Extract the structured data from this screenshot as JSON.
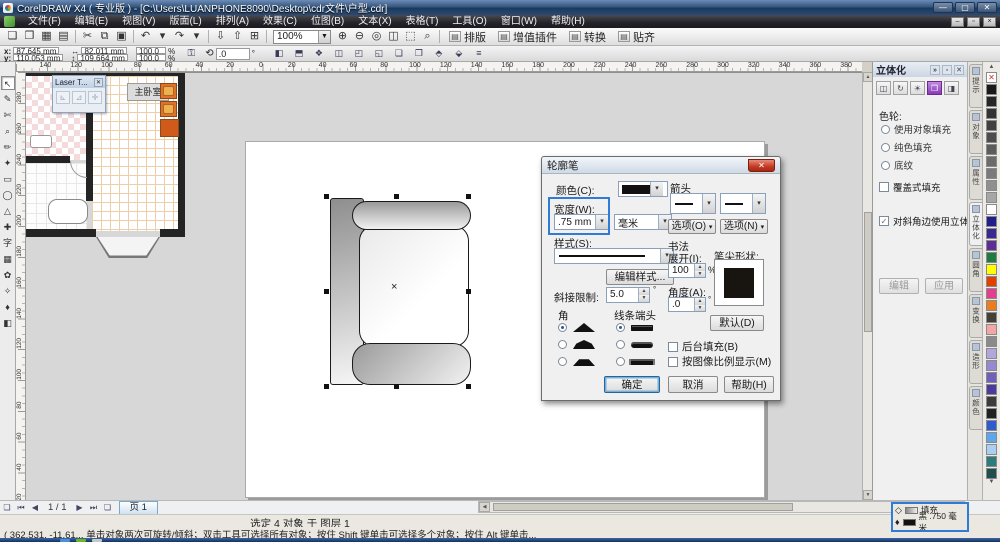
{
  "window": {
    "title": "CorelDRAW X4 ( 专业版 ) - [C:\\Users\\LUANPHONE8090\\Desktop\\cdr文件\\户型.cdr]",
    "minimize": "—",
    "maximize": "▢",
    "close": "✕"
  },
  "menu": {
    "items": [
      "文件(F)",
      "编辑(E)",
      "视图(V)",
      "版面(L)",
      "排列(A)",
      "效果(C)",
      "位图(B)",
      "文本(X)",
      "表格(T)",
      "工具(O)",
      "窗口(W)",
      "帮助(H)"
    ]
  },
  "toolbar": {
    "file_icons": [
      {
        "name": "new-icon",
        "glyph": "❏"
      },
      {
        "name": "open-icon",
        "glyph": "❐"
      },
      {
        "name": "save-icon",
        "glyph": "▦"
      },
      {
        "name": "print-icon",
        "glyph": "▤"
      }
    ],
    "edit_icons": [
      {
        "name": "cut-icon",
        "glyph": "✂"
      },
      {
        "name": "copy-icon",
        "glyph": "⧉"
      },
      {
        "name": "paste-icon",
        "glyph": "▣"
      }
    ],
    "undo_icons": [
      {
        "name": "undo-icon",
        "glyph": "↶"
      },
      {
        "name": "undo-dropdown-icon",
        "glyph": "▾"
      },
      {
        "name": "redo-icon",
        "glyph": "↷"
      },
      {
        "name": "redo-dropdown-icon",
        "glyph": "▾"
      }
    ],
    "io_icons": [
      {
        "name": "import-icon",
        "glyph": "⇩"
      },
      {
        "name": "export-icon",
        "glyph": "⇧"
      },
      {
        "name": "app-launcher-icon",
        "glyph": "⊞"
      }
    ],
    "zoom_value": "100%",
    "zoom_icons": [
      {
        "name": "zoom-in-icon",
        "glyph": "⊕"
      },
      {
        "name": "zoom-out-icon",
        "glyph": "⊖"
      },
      {
        "name": "zoom-selected-icon",
        "glyph": "◎"
      },
      {
        "name": "zoom-all-icon",
        "glyph": "◫"
      },
      {
        "name": "zoom-page-icon",
        "glyph": "⬚"
      },
      {
        "name": "zoom-width-icon",
        "glyph": "⌕"
      }
    ],
    "text_buttons": [
      {
        "label": "排版"
      },
      {
        "label": "增值插件"
      },
      {
        "label": "转换"
      },
      {
        "label": "贴齐"
      }
    ]
  },
  "property_bar": {
    "x_label": "x:",
    "x_value": "87.645 mm",
    "y_label": "y:",
    "y_value": "110.053 mm",
    "w_icon": "↔",
    "w_value": "82.011 mm",
    "h_icon": "↕",
    "h_value": "109.664 mm",
    "scale_x": "100.0",
    "scale_y": "100.0",
    "pct": "%",
    "rotate_icon": "⟲",
    "rotation": ".0",
    "deg": "°",
    "icons": [
      {
        "name": "mirror-h-icon",
        "glyph": "◧"
      },
      {
        "name": "mirror-v-icon",
        "glyph": "⬒"
      },
      {
        "name": "combine-icon",
        "glyph": "❖"
      },
      {
        "name": "weld-icon",
        "glyph": "◫"
      },
      {
        "name": "trim-icon",
        "glyph": "◰"
      },
      {
        "name": "intersect-icon",
        "glyph": "◱"
      },
      {
        "name": "group-icon",
        "glyph": "❏"
      },
      {
        "name": "ungroup-icon",
        "glyph": "❐"
      },
      {
        "name": "to-front-icon",
        "glyph": "⬘"
      },
      {
        "name": "to-back-icon",
        "glyph": "⬙"
      },
      {
        "name": "outline-width-icon",
        "glyph": "≡"
      }
    ]
  },
  "toolbox": {
    "tools": [
      {
        "name": "pick-tool",
        "glyph": "↖",
        "active": true
      },
      {
        "name": "shape-tool",
        "glyph": "✎"
      },
      {
        "name": "crop-tool",
        "glyph": "✄"
      },
      {
        "name": "zoom-tool",
        "glyph": "⌕"
      },
      {
        "name": "freehand-tool",
        "glyph": "✏"
      },
      {
        "name": "smart-fill-tool",
        "glyph": "✦"
      },
      {
        "name": "rectangle-tool",
        "glyph": "▭"
      },
      {
        "name": "ellipse-tool",
        "glyph": "◯"
      },
      {
        "name": "polygon-tool",
        "glyph": "△"
      },
      {
        "name": "basic-shapes-tool",
        "glyph": "✚"
      },
      {
        "name": "text-tool",
        "glyph": "字"
      },
      {
        "name": "table-tool",
        "glyph": "▦"
      },
      {
        "name": "blend-tool",
        "glyph": "✿"
      },
      {
        "name": "eyedropper-tool",
        "glyph": "✧"
      },
      {
        "name": "outline-tool",
        "glyph": "♦"
      },
      {
        "name": "fill-tool",
        "glyph": "◧"
      }
    ]
  },
  "ruler": {
    "h_labels": [
      "140",
      "120",
      "100",
      "80",
      "60",
      "40",
      "20",
      "0",
      "20",
      "40",
      "60",
      "80",
      "100",
      "120",
      "140",
      "160",
      "180",
      "200",
      "220",
      "240",
      "260",
      "280",
      "300",
      "320",
      "340",
      "360",
      "380"
    ],
    "v_labels": [
      "280",
      "260",
      "240",
      "220",
      "200",
      "180",
      "160",
      "140",
      "120",
      "100",
      "80",
      "60",
      "40",
      "20"
    ]
  },
  "floor_plan": {
    "room_label": "主卧室"
  },
  "laser_toolbar": {
    "title": "Laser T...",
    "close": "✕",
    "buttons": [
      {
        "name": "laser-tool-1-icon",
        "glyph": "⊾"
      },
      {
        "name": "laser-tool-2-icon",
        "glyph": "⊿"
      },
      {
        "name": "laser-tool-3-icon",
        "glyph": "✛"
      }
    ]
  },
  "dialog": {
    "title": "轮廓笔",
    "close": "✕",
    "color_label": "颜色(C):",
    "width_label": "宽度(W):",
    "width_value": ".75 mm",
    "width_unit": "毫米",
    "style_label": "样式(S):",
    "edit_style_button": "编辑样式...",
    "miter_label": "斜接限制:",
    "miter_value": "5.0",
    "miter_unit": "°",
    "corner_label": "角",
    "corner_selected_index": 0,
    "caps_label": "线条端头",
    "caps_selected_index": 0,
    "arrows_label": "箭头",
    "options_left": "选项(O)",
    "options_right": "选项(N)",
    "dropdown_glyph": "▾",
    "calligraphy_label": "书法",
    "stretch_label": "展开(I):",
    "stretch_value": "100",
    "stretch_unit": "%",
    "nib_label": "笔尖形状:",
    "angle_label": "角度(A):",
    "angle_value": ".0",
    "angle_unit": "°",
    "default_button": "默认(D)",
    "behind_fill_label": "后台填充(B)",
    "scale_image_label": "按图像比例显示(M)",
    "ok_button": "确定",
    "cancel_button": "取消",
    "help_button": "帮助(H)"
  },
  "docker": {
    "title": "立体化",
    "head_buttons": [
      "»",
      "▫",
      "✕"
    ],
    "tool_icons": [
      {
        "name": "extrude-camera-icon",
        "glyph": "◫"
      },
      {
        "name": "extrude-rotate-icon",
        "glyph": "↻"
      },
      {
        "name": "extrude-light-icon",
        "glyph": "☀"
      },
      {
        "name": "extrude-color-icon",
        "glyph": "❒",
        "active": true
      },
      {
        "name": "extrude-bevel-icon",
        "glyph": "◨"
      }
    ],
    "color_wheel_label": "色轮:",
    "radios": [
      {
        "label": "使用对象填充",
        "active": true
      },
      {
        "label": "纯色填充"
      },
      {
        "label": "底纹"
      }
    ],
    "checkboxes": [
      {
        "label": "覆盖式填充",
        "active": false
      },
      {
        "label": "对斜角边使用立体填充",
        "active": true
      }
    ],
    "edit_button": "编辑",
    "apply_button": "应用"
  },
  "docker_tabs": [
    {
      "label": "提示"
    },
    {
      "label": "对象"
    },
    {
      "label": "属性"
    },
    {
      "label": "立体化",
      "active": true
    },
    {
      "label": "圆角"
    },
    {
      "label": "变换"
    },
    {
      "label": "造形"
    },
    {
      "label": "颜色"
    }
  ],
  "palette": {
    "colors": [
      "none",
      "#1a1a1a",
      "#262626",
      "#333333",
      "#404040",
      "#4d4d4d",
      "#5c5c5c",
      "#6b6b6b",
      "#7a7a7a",
      "#8f8f8f",
      "#a6a6a6",
      "#ffffff",
      "#20208c",
      "#3a2a90",
      "#5c2e94",
      "#1e7a40",
      "#ffff00",
      "#e04000",
      "#e43e8e",
      "#ea7e1e",
      "#454036",
      "#f2a6a6",
      "#8a8a8a",
      "#b4a6dc",
      "#9888d0",
      "#7060ba",
      "#4c3a9c",
      "#3c3c3c",
      "#222222",
      "#2e5ccc",
      "#5ea6ea",
      "#aacff2",
      "#2c7c7c",
      "#1e4e4e"
    ]
  },
  "page_nav": {
    "add_page_left": "❏",
    "first": "⏮",
    "prev": "◀",
    "page_indicator": "1 / 1",
    "next": "▶",
    "last": "⏭",
    "add_page_right": "❏",
    "page_tab": "页 1"
  },
  "status": {
    "selection": "选定 4 对象 于 图层 1",
    "hint": "( 362.531, -11.61... 单击对象两次可旋转/倾斜；双击工具可选择所有对象；按住 Shift 键单击可选择多个对象；按住 Alt 键单击...",
    "fill_label": "填充",
    "outline_label": "黑 .750 毫米"
  },
  "colors": {
    "annotation": "#2f7bd6",
    "docker_active": "#8a3ab8",
    "taskbar": [
      "#4a90d9",
      "#68b723",
      "#c8c8c8"
    ]
  }
}
